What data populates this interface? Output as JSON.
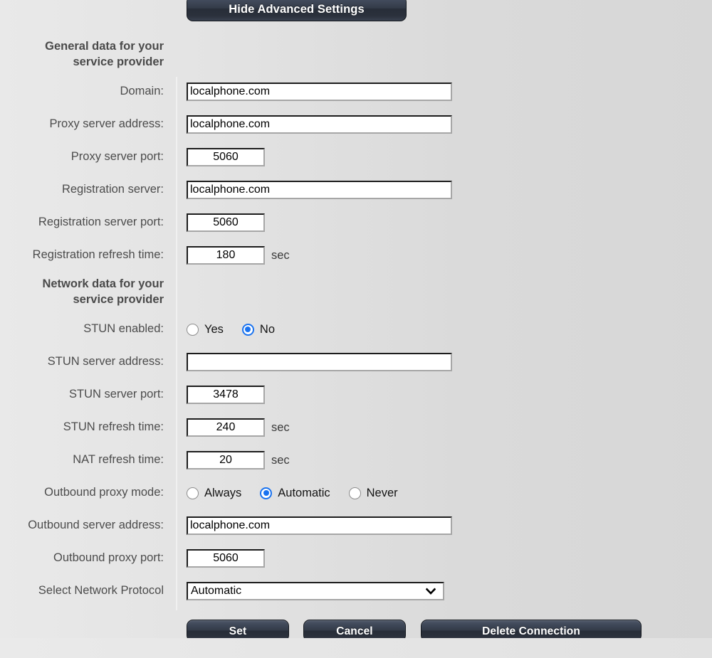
{
  "top_button": {
    "label": "Hide Advanced Settings",
    "name": "hide-advanced-settings-button"
  },
  "sections": {
    "general": {
      "heading_line1": "General data for your",
      "heading_line2": "service provider"
    },
    "network": {
      "heading_line1": "Network data for your",
      "heading_line2": "service provider"
    }
  },
  "fields": {
    "domain": {
      "label": "Domain:",
      "value": "localphone.com"
    },
    "proxy_server_address": {
      "label": "Proxy server address:",
      "value": "localphone.com"
    },
    "proxy_server_port": {
      "label": "Proxy server port:",
      "value": "5060"
    },
    "registration_server": {
      "label": "Registration server:",
      "value": "localphone.com"
    },
    "registration_server_port": {
      "label": "Registration server port:",
      "value": "5060"
    },
    "registration_refresh_time": {
      "label": "Registration refresh time:",
      "value": "180",
      "unit": "sec"
    },
    "stun_enabled": {
      "label": "STUN enabled:",
      "options": [
        "Yes",
        "No"
      ],
      "selected": "No"
    },
    "stun_server_address": {
      "label": "STUN server address:",
      "value": ""
    },
    "stun_server_port": {
      "label": "STUN server port:",
      "value": "3478"
    },
    "stun_refresh_time": {
      "label": "STUN refresh time:",
      "value": "240",
      "unit": "sec"
    },
    "nat_refresh_time": {
      "label": "NAT refresh time:",
      "value": "20",
      "unit": "sec"
    },
    "outbound_proxy_mode": {
      "label": "Outbound proxy mode:",
      "options": [
        "Always",
        "Automatic",
        "Never"
      ],
      "selected": "Automatic"
    },
    "outbound_server_address": {
      "label": "Outbound server address:",
      "value": "localphone.com"
    },
    "outbound_proxy_port": {
      "label": "Outbound proxy port:",
      "value": "5060"
    },
    "network_protocol": {
      "label": "Select Network Protocol",
      "value": "Automatic"
    }
  },
  "buttons": {
    "set": "Set",
    "cancel": "Cancel",
    "delete": "Delete Connection"
  },
  "colors": {
    "accent_radio": "#1a73f0",
    "button_dark": "#2f3642",
    "page_background": "#e0e0e0"
  }
}
